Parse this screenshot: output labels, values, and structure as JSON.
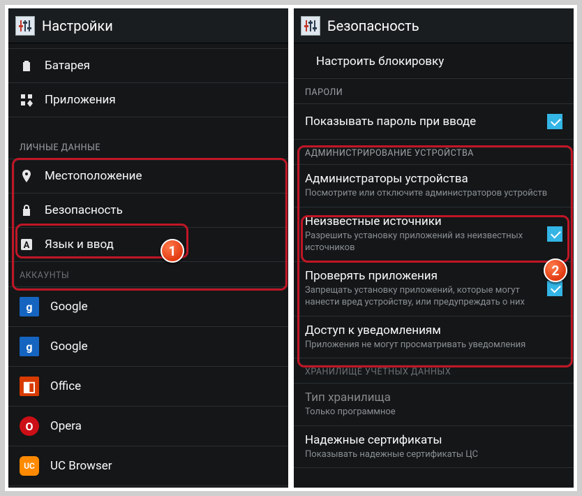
{
  "left": {
    "title": "Настройки",
    "items_top": [
      {
        "label": "Батарея",
        "icon": "battery"
      },
      {
        "label": "Приложения",
        "icon": "apps"
      }
    ],
    "section_personal": "ЛИЧНЫЕ ДАННЫЕ",
    "personal_items": [
      {
        "label": "Местоположение",
        "icon": "location"
      },
      {
        "label": "Безопасность",
        "icon": "lock"
      },
      {
        "label": "Язык и ввод",
        "icon": "lang"
      }
    ],
    "section_accounts": "АККАУНТЫ",
    "accounts": [
      {
        "label": "Google",
        "icon": "google"
      },
      {
        "label": "Google",
        "icon": "google"
      },
      {
        "label": "Office",
        "icon": "office"
      },
      {
        "label": "Opera",
        "icon": "opera"
      },
      {
        "label": "UC Browser",
        "icon": "uc"
      }
    ]
  },
  "right": {
    "title": "Безопасность",
    "configure_lock": "Настроить блокировку",
    "section_passwords": "ПАРОЛИ",
    "show_password": {
      "label": "Показывать пароль при вводе",
      "checked": true
    },
    "section_admin": "АДМИНИСТРИРОВАНИЕ УСТРОЙСТВА",
    "admin_items": [
      {
        "label": "Администраторы устройства",
        "sub": "Посмотрите или отключите администраторов устройств"
      },
      {
        "label": "Неизвестные источники",
        "sub": "Разрешить установку приложений из неизвестных источников",
        "checked": true
      },
      {
        "label": "Проверять приложения",
        "sub": "Запрещать установку приложений, которые могут нанести вред устройству, или предупреждать о них",
        "checked": true
      },
      {
        "label": "Доступ к уведомлениям",
        "sub": "Приложения не могут просматривать уведомления"
      }
    ],
    "section_storage": "ХРАНИЛИЩЕ УЧЕТНЫХ ДАННЫХ",
    "storage_type": {
      "label": "Тип хранилища",
      "sub": "Только программное"
    },
    "trusted_certs": {
      "label": "Надежные сертификаты",
      "sub": "Показывать надежные сертификаты ЦС"
    }
  },
  "badges": {
    "one": "1",
    "two": "2"
  }
}
